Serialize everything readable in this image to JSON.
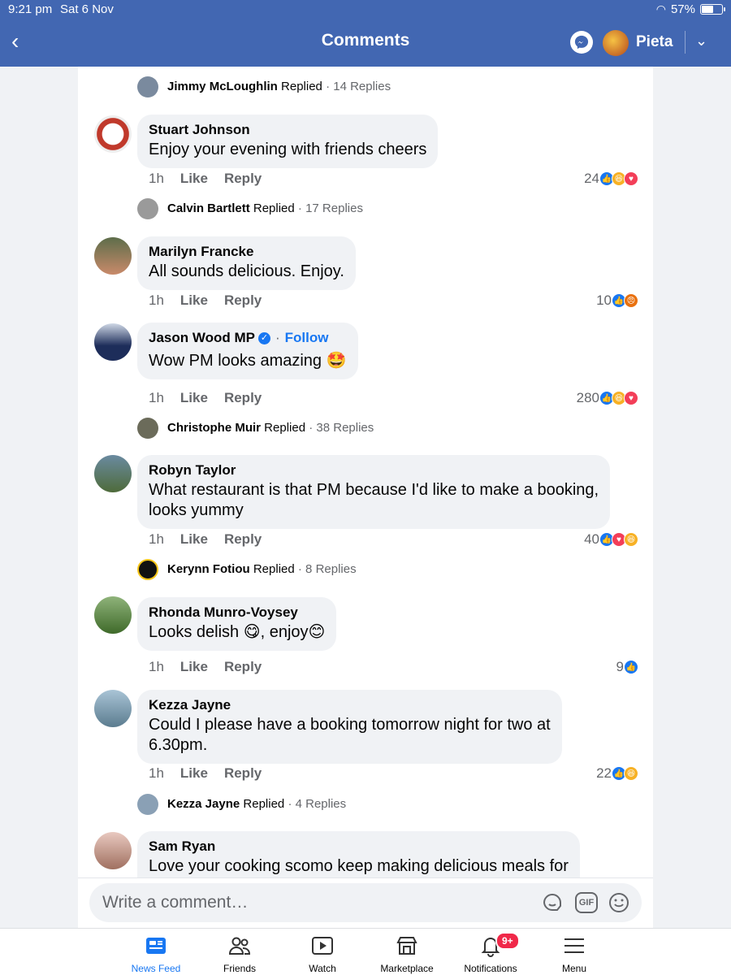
{
  "status_bar": {
    "time": "9:21 pm",
    "date": "Sat 6 Nov",
    "battery": "57%",
    "battery_level": 0.57
  },
  "header": {
    "title": "Comments",
    "user_name": "Pieta"
  },
  "replies_summary": [
    {
      "name": "Jimmy McLoughlin",
      "verb": "Replied",
      "count": "· 14 Replies"
    },
    {
      "name": "Calvin Bartlett",
      "verb": "Replied",
      "count": "· 17 Replies"
    },
    {
      "name": "Christophe Muir",
      "verb": "Replied",
      "count": "· 38 Replies"
    },
    {
      "name": "Kerynn Fotiou",
      "verb": "Replied",
      "count": "· 8 Replies"
    },
    {
      "name": "Kezza Jayne",
      "verb": "Replied",
      "count": "· 4 Replies"
    }
  ],
  "comments": [
    {
      "name": "Stuart Johnson",
      "text": "Enjoy your evening with friends cheers",
      "time": "1h",
      "like": "Like",
      "reply": "Reply",
      "reaction_count": "24",
      "reactions": [
        "like",
        "haha",
        "love"
      ]
    },
    {
      "name": "Marilyn Francke",
      "text": "All sounds delicious. Enjoy.",
      "time": "1h",
      "like": "Like",
      "reply": "Reply",
      "reaction_count": "10",
      "reactions": [
        "like",
        "angry"
      ]
    },
    {
      "name": "Jason Wood MP",
      "follow": "Follow",
      "text": "Wow PM looks amazing 🤩",
      "time": "1h",
      "like": "Like",
      "reply": "Reply",
      "reaction_count": "280",
      "reactions": [
        "like",
        "haha",
        "love"
      ]
    },
    {
      "name": "Robyn Taylor",
      "text": "What restaurant is that PM because I'd like to make a booking,\nlooks yummy",
      "time": "1h",
      "like": "Like",
      "reply": "Reply",
      "reaction_count": "40",
      "reactions": [
        "like",
        "love",
        "haha"
      ]
    },
    {
      "name": "Rhonda Munro-Voysey",
      "text": "Looks delish 😋, enjoy😊",
      "time": "1h",
      "like": "Like",
      "reply": "Reply",
      "reaction_count": "9",
      "reactions": [
        "like"
      ]
    },
    {
      "name": "Kezza Jayne",
      "text": "Could I please have a booking tomorrow night for two at\n6.30pm.",
      "time": "1h",
      "like": "Like",
      "reply": "Reply",
      "reaction_count": "22",
      "reactions": [
        "like",
        "haha"
      ]
    },
    {
      "name": "Sam Ryan",
      "text": "Love your cooking scomo keep making delicious meals for"
    }
  ],
  "composer": {
    "placeholder": "Write a comment…",
    "gif_label": "GIF"
  },
  "bottom_nav": [
    {
      "label": "News Feed",
      "icon": "news-feed-icon",
      "active": true
    },
    {
      "label": "Friends",
      "icon": "friends-icon"
    },
    {
      "label": "Watch",
      "icon": "watch-icon"
    },
    {
      "label": "Marketplace",
      "icon": "marketplace-icon"
    },
    {
      "label": "Notifications",
      "icon": "bell-icon",
      "badge": "9+"
    },
    {
      "label": "Menu",
      "icon": "menu-icon"
    }
  ],
  "colors": {
    "header_bg": "#4267b2",
    "accent": "#1877f2",
    "badge": "#f02849"
  }
}
